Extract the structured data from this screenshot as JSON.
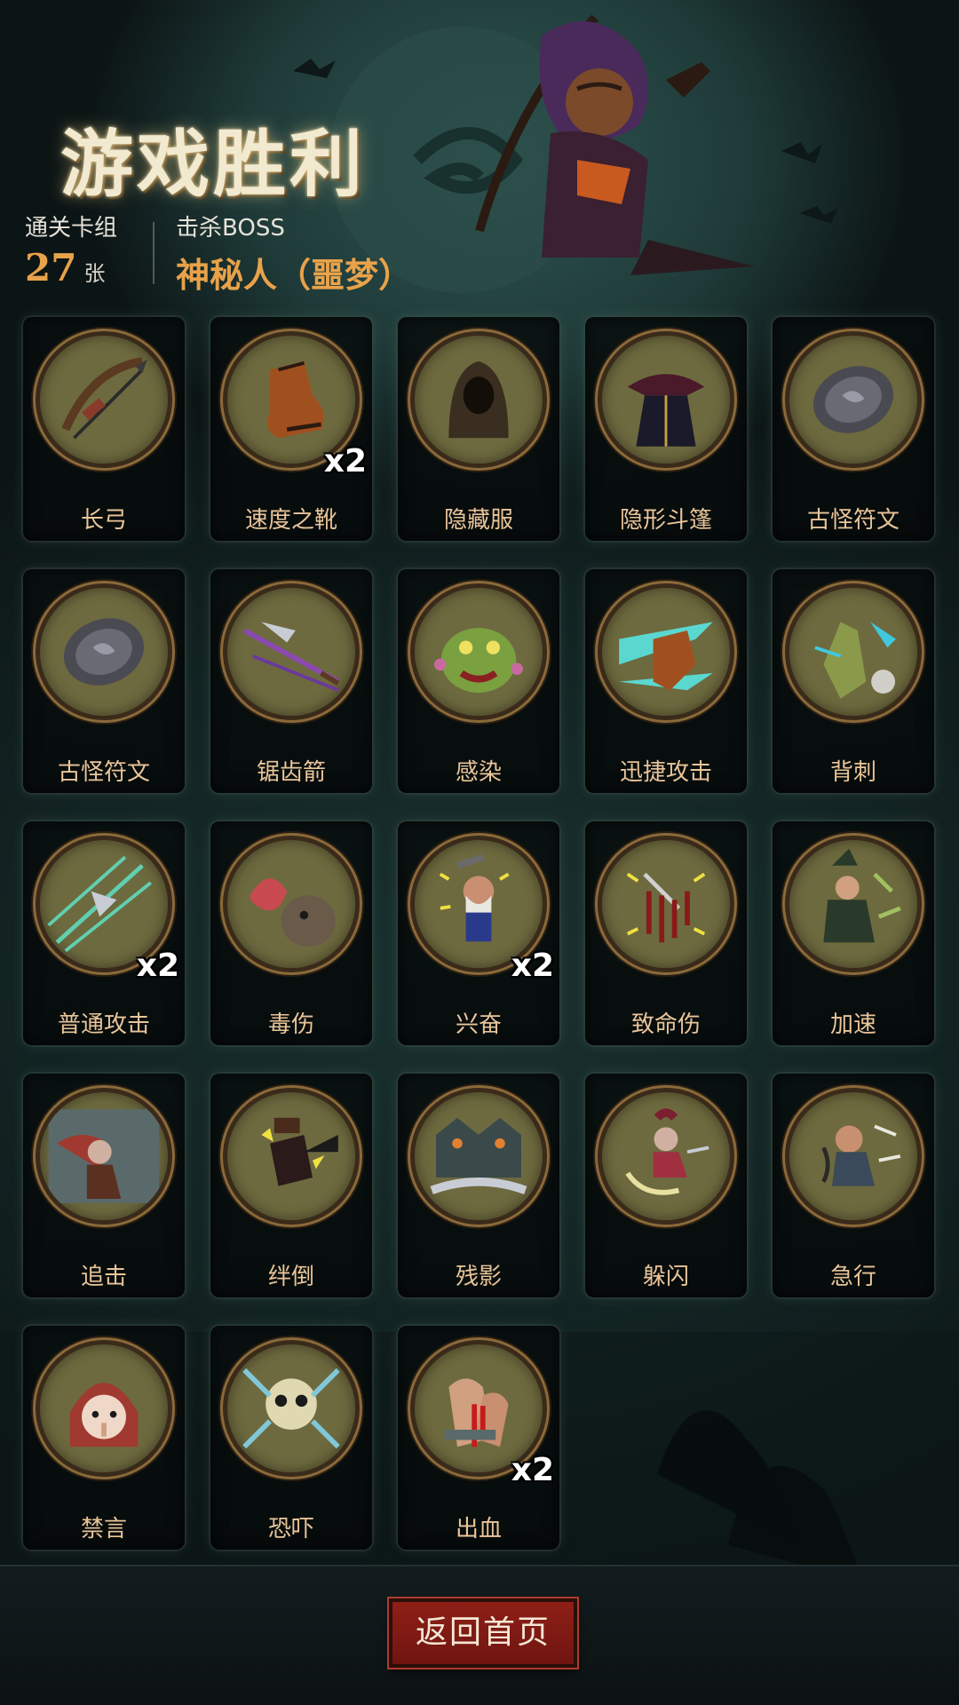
{
  "header": {
    "title": "游戏胜利",
    "deck_label": "通关卡组",
    "deck_count": "27",
    "deck_unit": "张",
    "boss_label": "击杀BOSS",
    "boss_name": "神秘人（噩梦）"
  },
  "cards": [
    {
      "name": "长弓",
      "count": "",
      "icon": "longbow-icon"
    },
    {
      "name": "速度之靴",
      "count": "x2",
      "icon": "speed-boots-icon"
    },
    {
      "name": "隐藏服",
      "count": "",
      "icon": "hooded-cloak-icon"
    },
    {
      "name": "隐形斗篷",
      "count": "",
      "icon": "invisibility-cloak-icon"
    },
    {
      "name": "古怪符文",
      "count": "",
      "icon": "rune-stone-icon"
    },
    {
      "name": "古怪符文",
      "count": "",
      "icon": "rune-stone-icon"
    },
    {
      "name": "锯齿箭",
      "count": "",
      "icon": "serrated-arrow-icon"
    },
    {
      "name": "感染",
      "count": "",
      "icon": "infection-monster-icon"
    },
    {
      "name": "迅捷攻击",
      "count": "",
      "icon": "swift-strike-icon"
    },
    {
      "name": "背刺",
      "count": "",
      "icon": "backstab-icon"
    },
    {
      "name": "普通攻击",
      "count": "x2",
      "icon": "arrow-volley-icon"
    },
    {
      "name": "毒伤",
      "count": "",
      "icon": "poison-tentacle-icon"
    },
    {
      "name": "兴奋",
      "count": "x2",
      "icon": "excited-dwarf-icon"
    },
    {
      "name": "致命伤",
      "count": "",
      "icon": "fatal-wound-icon"
    },
    {
      "name": "加速",
      "count": "",
      "icon": "haste-witch-icon"
    },
    {
      "name": "追击",
      "count": "",
      "icon": "pursuit-icon"
    },
    {
      "name": "绊倒",
      "count": "",
      "icon": "trip-boot-icon"
    },
    {
      "name": "残影",
      "count": "",
      "icon": "afterimage-icon"
    },
    {
      "name": "躲闪",
      "count": "",
      "icon": "dodge-icon"
    },
    {
      "name": "急行",
      "count": "",
      "icon": "dash-warrior-icon"
    },
    {
      "name": "禁言",
      "count": "",
      "icon": "silence-girl-icon"
    },
    {
      "name": "恐吓",
      "count": "",
      "icon": "intimidate-skull-icon"
    },
    {
      "name": "出血",
      "count": "x2",
      "icon": "bleeding-arm-icon"
    }
  ],
  "footer": {
    "home_button": "返回首页"
  },
  "colors": {
    "accent": "#e8a24a",
    "card_name": "#e9c59a",
    "button_red": "#8e1f17"
  }
}
